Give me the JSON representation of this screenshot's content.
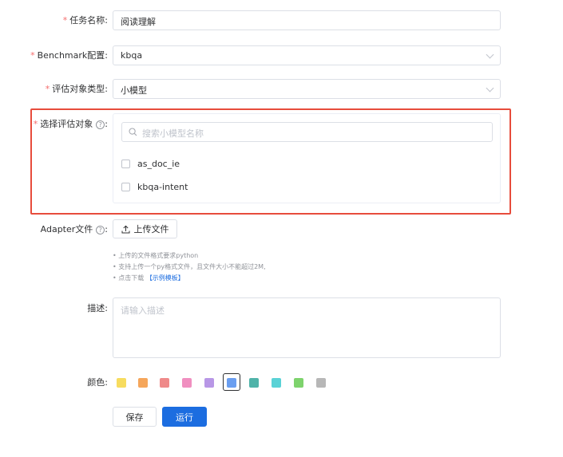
{
  "form": {
    "task_name": {
      "label": "任务名称:",
      "value": "阅读理解"
    },
    "benchmark": {
      "label": "Benchmark配置:",
      "value": "kbqa"
    },
    "eval_type": {
      "label": "评估对象类型:",
      "value": "小模型"
    },
    "eval_target": {
      "label": "选择评估对象",
      "colon": ":",
      "help": "?",
      "search_placeholder": "搜索小模型名称",
      "options": [
        "as_doc_ie",
        "kbqa-intent"
      ]
    },
    "adapter": {
      "label": "Adapter文件",
      "colon": ":",
      "help": "?",
      "upload_label": "上传文件",
      "tips": [
        "上传的文件格式要求python",
        "支持上传一个py格式文件，且文件大小不能超过2M,",
        "点击下载"
      ],
      "template_link": "【示例模板】"
    },
    "description": {
      "label": "描述:",
      "placeholder": "请输入描述"
    },
    "color": {
      "label": "颜色:",
      "swatches": [
        "#f7dc5f",
        "#f5a65b",
        "#ef8a8a",
        "#f08fc0",
        "#b897e6",
        "#6a9ef0",
        "#4fb3a9",
        "#5ad2d6",
        "#7ed36d",
        "#b7b7b7"
      ],
      "selected_index": 5
    }
  },
  "actions": {
    "save_label": "保存",
    "run_label": "运行"
  },
  "required_mark": "*",
  "bullet": "•",
  "colors": {
    "primary": "#1c6de0",
    "highlight_border": "#e74c3c",
    "required": "#f56c6c"
  }
}
